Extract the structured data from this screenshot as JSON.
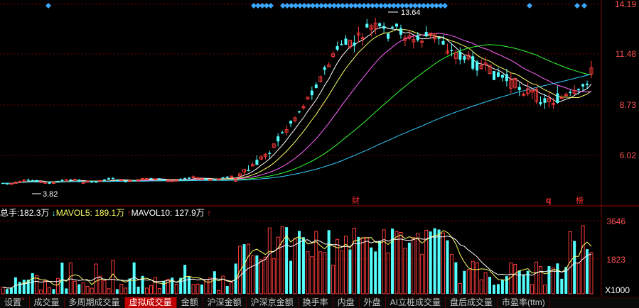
{
  "price_axis": {
    "labels": [
      "14.19",
      "11.48",
      "8.73",
      "6.02"
    ]
  },
  "volume_axis": {
    "labels": [
      "3646",
      "1823",
      "X1000"
    ]
  },
  "annotations": {
    "high": "13.64",
    "low": "3.82",
    "marker_cai": "财",
    "marker_q": "q",
    "marker_bang": "榜"
  },
  "volume_legend": {
    "total_label": "总手:",
    "total_value": "182.3万",
    "ma5_arrow": "↓",
    "ma5_label": "MAVOL5:",
    "ma5_value": "189.1万",
    "ma10_arrow": "↑",
    "ma10_label": "MAVOL10:",
    "ma10_value": "127.9万",
    "tail_arrow": "↑"
  },
  "tabs": [
    {
      "label": "设置",
      "dot": "*"
    },
    {
      "label": "成交量"
    },
    {
      "label": "多周期成交量"
    },
    {
      "label": "虚拟成交量",
      "active": true
    },
    {
      "label": "金额"
    },
    {
      "label": "沪深金额"
    },
    {
      "label": "沪深京金额"
    },
    {
      "label": "换手率"
    },
    {
      "label": "内盘"
    },
    {
      "label": "外盘"
    },
    {
      "label": "AI立桩成交量"
    },
    {
      "label": "盘后成交量"
    },
    {
      "label": "市盈率(ttm)"
    }
  ],
  "colors": {
    "up": "#ff3c3c",
    "down": "#54ffff",
    "grid": "#7a0000",
    "axis_text": "#ff5050",
    "ma_yellow": "#ffff66",
    "ma_white": "#ffffff",
    "ma_magenta": "#ff66ff",
    "ma_green": "#33ff33",
    "ma_cyan": "#33ccff",
    "diamond": "#3aa8ff"
  }
}
